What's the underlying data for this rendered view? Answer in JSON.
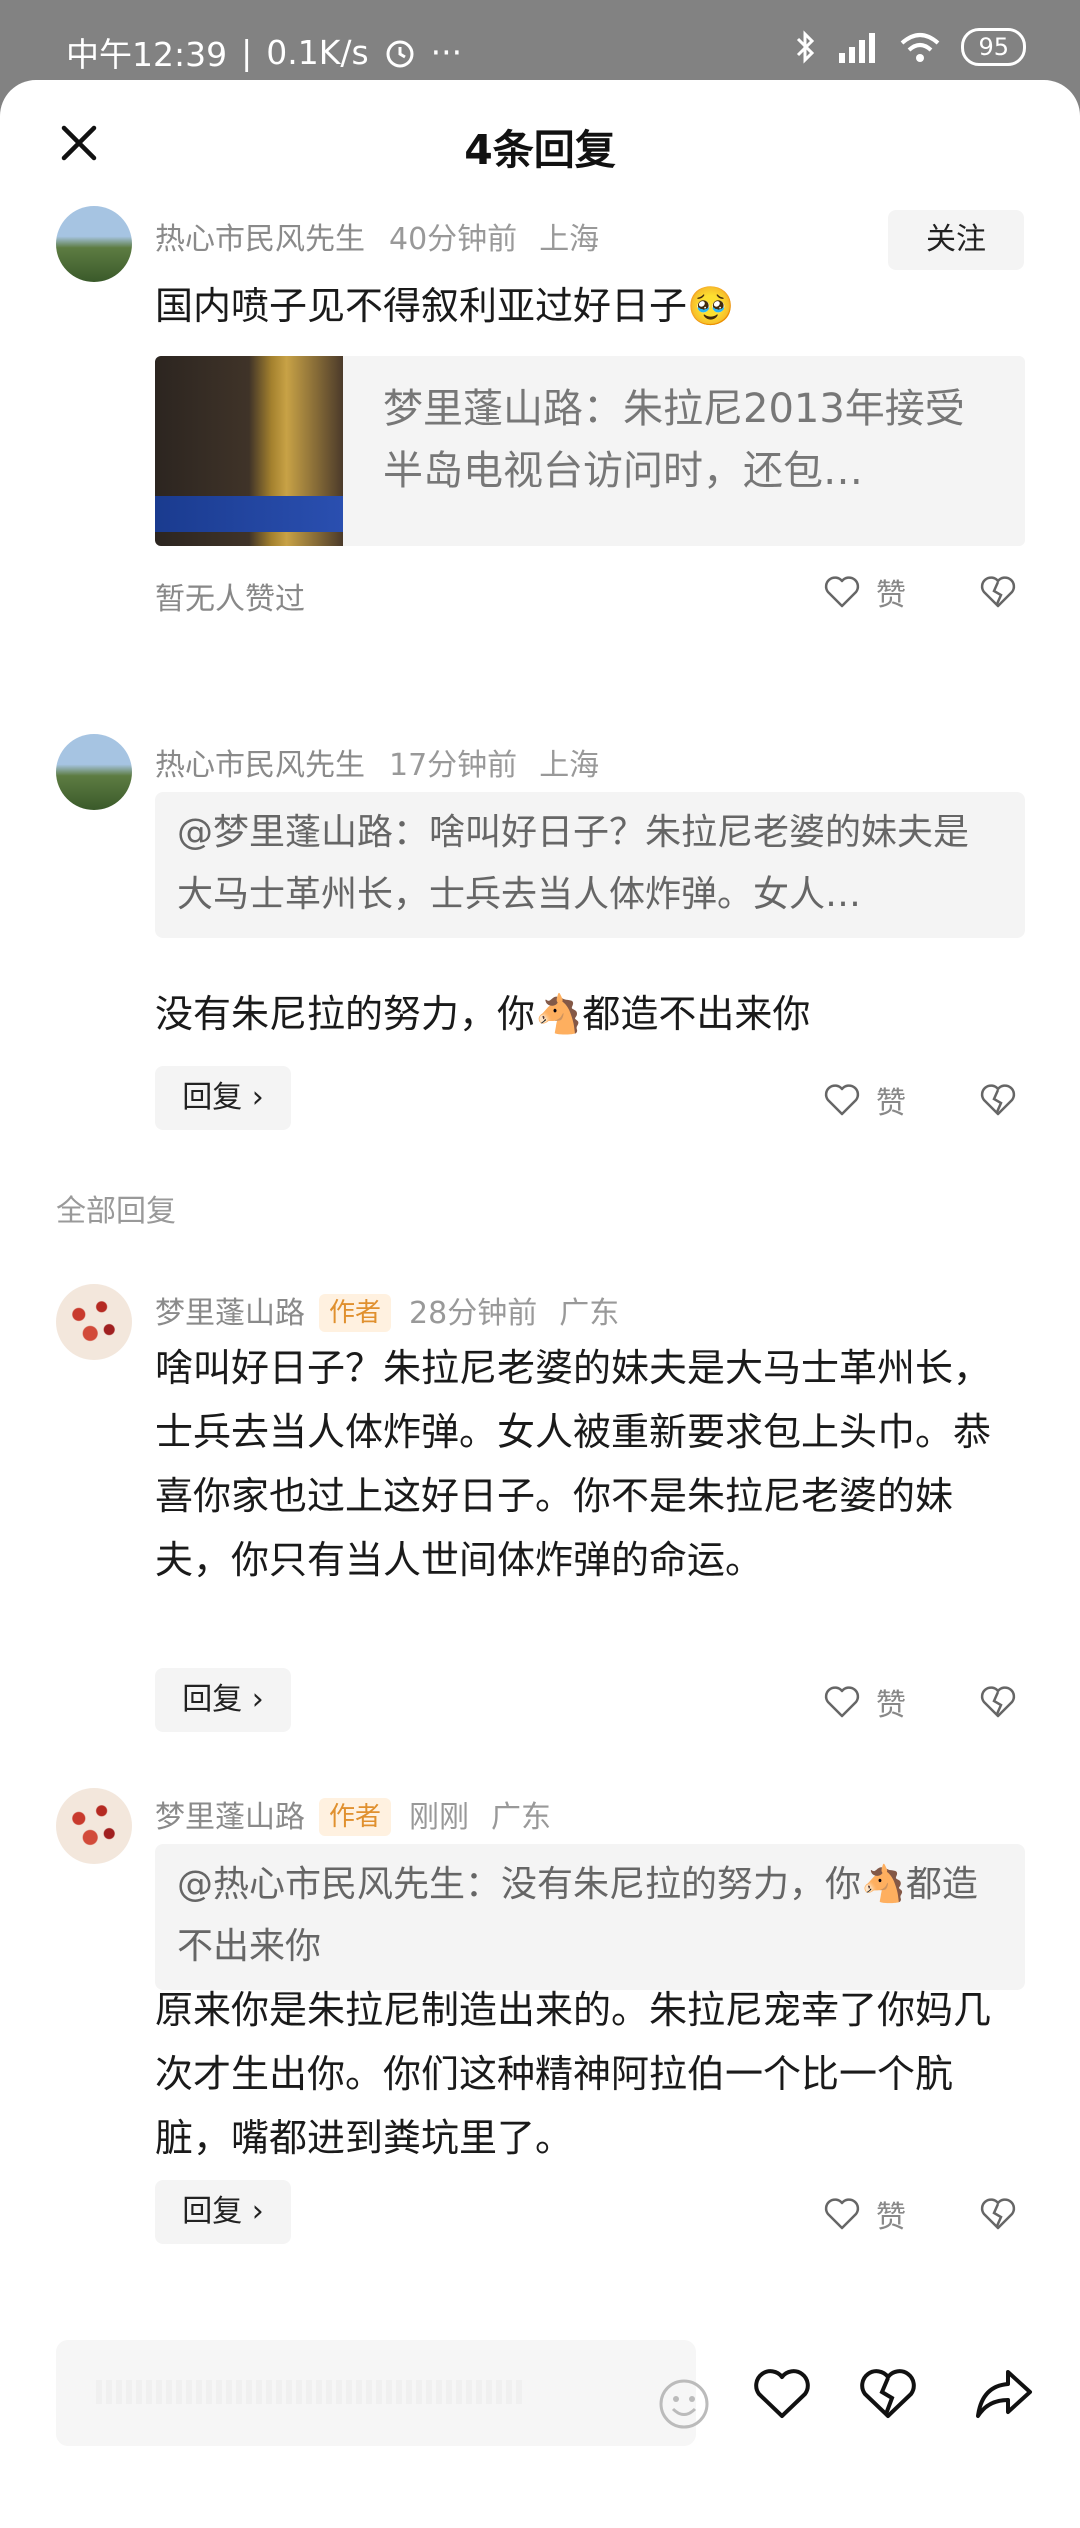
{
  "status_bar": {
    "time": "中午12:39",
    "net_speed": "0.1K/s",
    "dots": "···",
    "battery": "95",
    "icons": [
      "alarm-icon",
      "bluetooth-icon",
      "signal-icon",
      "wifi-icon"
    ]
  },
  "header": {
    "title": "4条回复",
    "close_icon": "close-icon"
  },
  "top_comment": {
    "author": "热心市民风先生",
    "time": "40分钟前",
    "location": "上海",
    "follow_label": "关注",
    "text": "国内喷子见不得叙利亚过好日子🥹",
    "link_card_text": "梦里蓬山路：朱拉尼2013年接受半岛电视台访问时，还包…",
    "no_likes": "暂无人赞过",
    "like_label": "赞"
  },
  "reply_1": {
    "author": "热心市民风先生",
    "time": "17分钟前",
    "location": "上海",
    "quote": "@梦里蓬山路：啥叫好日子？朱拉尼老婆的妹夫是大马士革州长，士兵去当人体炸弹。女人…",
    "text": "没有朱尼拉的努力，你🐴都造不出来你",
    "reply_label": "回复 ›",
    "like_label": "赞"
  },
  "section_label": "全部回复",
  "reply_2": {
    "author": "梦里蓬山路",
    "badge": "作者",
    "time": "28分钟前",
    "location": "广东",
    "text": "啥叫好日子？朱拉尼老婆的妹夫是大马士革州长，士兵去当人体炸弹。女人被重新要求包上头巾。恭喜你家也过上这好日子。你不是朱拉尼老婆的妹夫，你只有当人世间体炸弹的命运。",
    "reply_label": "回复 ›",
    "like_label": "赞"
  },
  "reply_3": {
    "author": "梦里蓬山路",
    "badge": "作者",
    "time": "刚刚",
    "location": "广东",
    "quote": "@热心市民风先生：没有朱尼拉的努力，你🐴都造不出来你",
    "text": "原来你是朱拉尼制造出来的。朱拉尼宠幸了你妈几次才生出你。你们这种精神阿拉伯一个比一个肮脏，嘴都进到粪坑里了。",
    "reply_label": "回复 ›",
    "like_label": "赞"
  },
  "bottom_bar": {
    "icons": [
      "emoji-icon",
      "heart-icon",
      "broken-heart-icon",
      "share-icon"
    ]
  },
  "nav_bar": {
    "icons": [
      "menu-icon",
      "home-icon",
      "back-icon"
    ]
  },
  "colors": {
    "sheet_bg": "#ffffff",
    "dim_bg": "#828282",
    "badge_text": "#e0902e",
    "badge_bg": "#fff1e0"
  }
}
